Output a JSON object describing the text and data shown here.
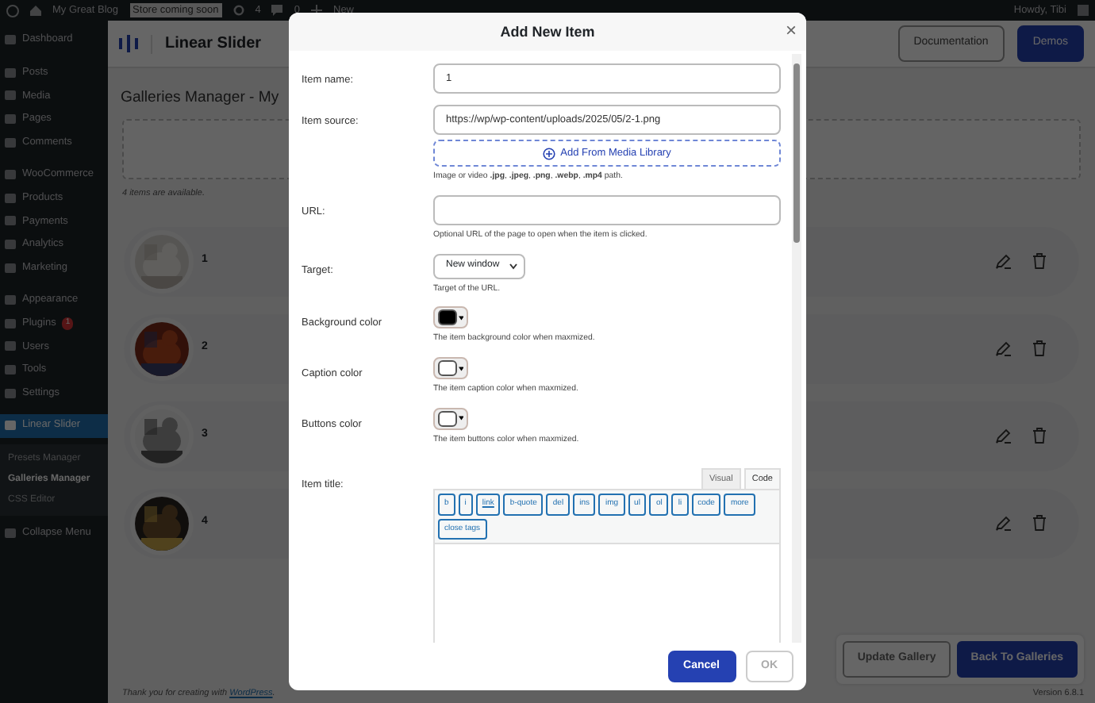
{
  "admin_bar": {
    "site": "My Great Blog",
    "badge": "Store coming soon",
    "updates": "4",
    "comments": "0",
    "new": "New",
    "greeting": "Howdy, Tibi"
  },
  "sidebar": {
    "groups": [
      [
        {
          "label": "Dashboard",
          "selected": false
        }
      ],
      [
        {
          "label": "Posts",
          "selected": false
        },
        {
          "label": "Media",
          "selected": false
        },
        {
          "label": "Pages",
          "selected": false
        },
        {
          "label": "Comments",
          "selected": false
        }
      ],
      [
        {
          "label": "WooCommerce",
          "selected": false
        },
        {
          "label": "Products",
          "selected": false
        },
        {
          "label": "Payments",
          "selected": false
        },
        {
          "label": "Analytics",
          "selected": false
        },
        {
          "label": "Marketing",
          "selected": false
        }
      ],
      [
        {
          "label": "Appearance",
          "selected": false
        },
        {
          "label": "Plugins",
          "badge": "1",
          "selected": false
        },
        {
          "label": "Users",
          "selected": false
        },
        {
          "label": "Tools",
          "selected": false
        },
        {
          "label": "Settings",
          "selected": false
        }
      ],
      [
        {
          "label": "Linear Slider",
          "selected": true
        }
      ]
    ],
    "submenu": [
      {
        "label": "Presets Manager",
        "selected": false
      },
      {
        "label": "Galleries Manager",
        "selected": true
      },
      {
        "label": "CSS Editor",
        "selected": false
      }
    ],
    "collapse": "Collapse Menu"
  },
  "header": {
    "title": "Linear Slider",
    "buttons": [
      {
        "label": "Documentation",
        "kind": "outline"
      },
      {
        "label": "Demos",
        "kind": "primary"
      }
    ]
  },
  "page": {
    "title": "Galleries Manager - My",
    "count": "4 items are available.",
    "items": [
      {
        "name": "1",
        "kind": "picture"
      },
      {
        "name": "2",
        "kind": "picture"
      },
      {
        "name": "3",
        "kind": "picture"
      },
      {
        "name": "4",
        "kind": "picture"
      }
    ],
    "footer_text": "Thank you for creating with ",
    "footer_link": "WordPress",
    "footer_end": ".",
    "version": "Version 6.8.1",
    "buttons": [
      {
        "label": "Update Gallery",
        "kind": "outline"
      },
      {
        "label": "Back To Galleries",
        "kind": "primary"
      }
    ]
  },
  "modal": {
    "title": "Add New Item",
    "close": "×",
    "fields": [
      {
        "kind": "text",
        "label": "Item name:",
        "value": "1"
      },
      {
        "kind": "source",
        "label": "Item source:",
        "value": "https://wp/wp-content/uploads/2025/05/2-1.png",
        "button": "Add From Media Library",
        "help": "Image or video **.jpg**, **.jpeg**, **.png**, **.webp**, **.mp4** path."
      },
      {
        "kind": "text",
        "label": "URL:",
        "help": "Optional URL of the page to open when the item is clicked."
      },
      {
        "kind": "select",
        "label": "Target:",
        "value": "New window",
        "help": "Target of the URL."
      },
      {
        "kind": "color",
        "label": "Background color",
        "color": "#000000",
        "help": "The item background color when maxmized."
      },
      {
        "kind": "color",
        "label": "Caption color",
        "color": "#ffffff",
        "help": "The item caption color when maxmized."
      },
      {
        "kind": "color",
        "label": "Buttons color",
        "color": "#ffffff",
        "help": "The item buttons color when maxmized."
      },
      {
        "kind": "editor",
        "label": "Item title:",
        "tabs": [
          {
            "label": "Visual",
            "selected": false
          },
          {
            "label": "Code",
            "selected": true
          }
        ],
        "tags": [
          "b",
          "i",
          "link",
          "b-quote",
          "del",
          "ins",
          "img",
          "ul",
          "ol",
          "li",
          "code",
          "more",
          "close tags"
        ]
      }
    ],
    "buttons": [
      {
        "label": "Cancel",
        "kind": "primary"
      },
      {
        "label": "OK",
        "kind": "disabled"
      }
    ]
  }
}
